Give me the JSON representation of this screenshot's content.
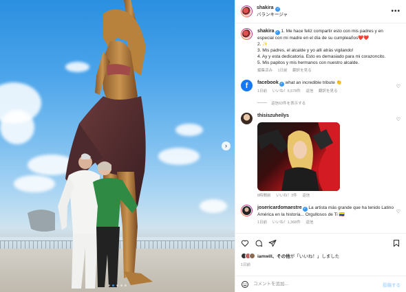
{
  "post": {
    "username": "shakira",
    "subtitle": "バランキージャ",
    "more_label": "•••"
  },
  "caption": {
    "username": "shakira",
    "lines": [
      "1. Me hace feliz compartir esto con mis padres y en especial con mi madre en el día de su cumpleaños❤️❤️",
      "2. ✨",
      "3. Mis padres, el alcalde y yo allí atrás vigilando!",
      "4. Ay y esta dedicatoria. Esto es demasiado para mi corazoncito.",
      "5. Mis papitos y mis hermanos con nuestro alcalde."
    ],
    "meta": [
      "編集済み",
      "1日前",
      "翻訳を見る"
    ]
  },
  "comments": [
    {
      "username": "facebook",
      "text": "what an incredible tribute 👏",
      "meta": [
        "1日前",
        "いいね！5,578件",
        "返信",
        "翻訳を見る"
      ],
      "replies": "返信63件を表示する"
    },
    {
      "username": "thisiszuheilys",
      "meta": [
        "8時間前",
        "いいね！3件",
        "返信"
      ]
    },
    {
      "username": "josericardomaestre",
      "text": "La artista más grande que ha tenido Latino América en la historia... Orgullosos de Ti 🇨🇴",
      "meta": [
        "1日前",
        "いいね！1,368件",
        "返信"
      ]
    }
  ],
  "likes": {
    "by": "iamwill、その他",
    "suffix": "が「いいね！」しました"
  },
  "date": "1日前",
  "compose": {
    "placeholder": "コメントを追加...",
    "post_label": "投稿する"
  },
  "carousel": {
    "total": 5,
    "active": 1
  },
  "colors": {
    "verified": "#3897f0",
    "link": "#00376b",
    "post_btn": "#b3dbff"
  }
}
